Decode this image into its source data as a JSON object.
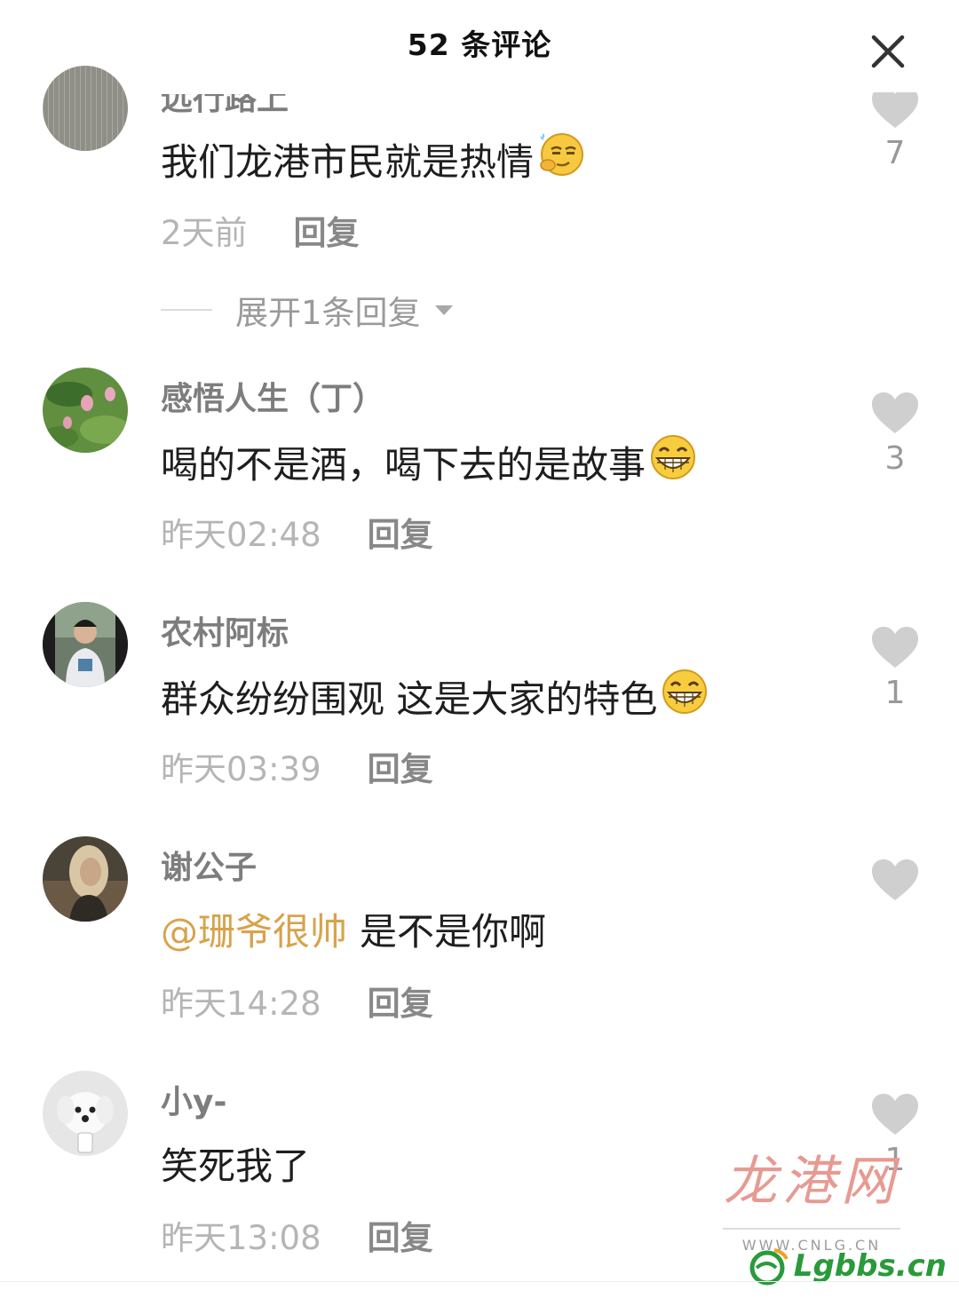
{
  "header": {
    "title": "52 条评论"
  },
  "comments": [
    {
      "user": "远行路上",
      "text": "我们龙港市民就是热情",
      "emoji": "smirk-emoji",
      "time": "2天前",
      "reply": "回复",
      "likes": "7"
    },
    {
      "user": "感悟人生（丁）",
      "text": "喝的不是酒，喝下去的是故事",
      "emoji": "grin-emoji",
      "time": "昨天02:48",
      "reply": "回复",
      "likes": "3"
    },
    {
      "user": "农村阿标",
      "text": "群众纷纷围观 这是大家的特色",
      "emoji": "grin-emoji",
      "time": "昨天03:39",
      "reply": "回复",
      "likes": "1"
    },
    {
      "user": "谢公子",
      "mention": "@珊爷很帅",
      "text": "是不是你啊",
      "time": "昨天14:28",
      "reply": "回复",
      "likes": ""
    },
    {
      "user": "小y-",
      "text": "笑死我了",
      "time": "昨天13:08",
      "reply": "回复",
      "likes": "1"
    }
  ],
  "expand_replies": "展开1条回复",
  "watermark": {
    "logo": "龙港网",
    "url": "WWW.CNLG.CN"
  },
  "bottom_logo": "Lgbbs.cn",
  "colors": {
    "mention": "#d7a34b",
    "heart": "#cfcfcf",
    "meta": "#b5b5b5"
  }
}
